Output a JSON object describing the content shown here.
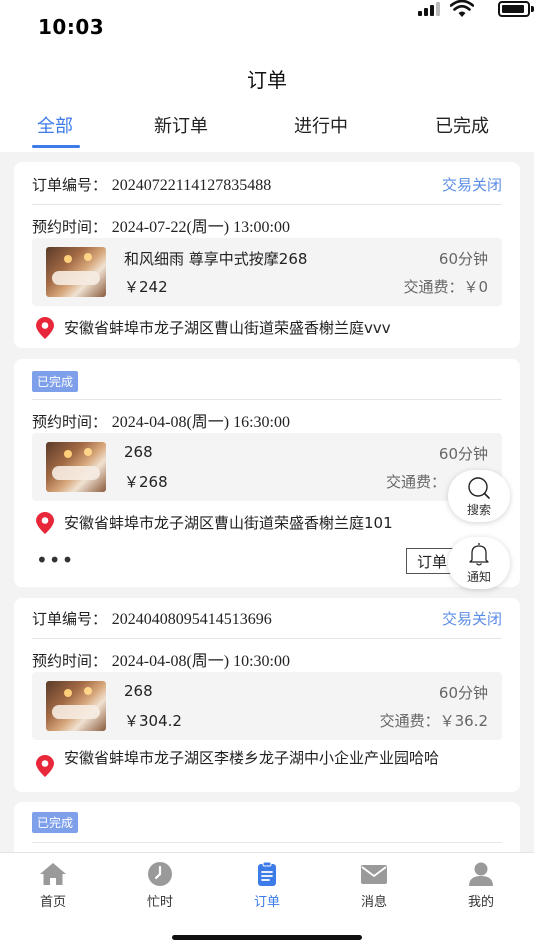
{
  "status_bar": {
    "time": "10:03"
  },
  "header": {
    "title": "订单"
  },
  "tabs": [
    {
      "label": "全部",
      "active": true
    },
    {
      "label": "新订单",
      "active": false
    },
    {
      "label": "进行中",
      "active": false
    },
    {
      "label": "已完成",
      "active": false
    }
  ],
  "orders": [
    {
      "order_no_label": "订单编号：",
      "order_no": "20240722114127835488",
      "status": "交易关闭",
      "time_label": "预约时间：",
      "time": "2024-07-22(周一) 13:00:00",
      "service_name": "和风细雨 尊享中式按摩268",
      "duration": "60分钟",
      "price": "￥242",
      "fee": "交通费：￥0",
      "address": "安徽省蚌埠市龙子湖区曹山街道荣盛香榭兰庭vvv"
    },
    {
      "badge": "已完成",
      "time_label": "预约时间：",
      "time": "2024-04-08(周一) 16:30:00",
      "service_name": "268",
      "duration": "60分钟",
      "price": "￥268",
      "fee": "交通费：",
      "address": "安徽省蚌埠市龙子湖区曹山街道荣盛香榭兰庭101",
      "more": "•••",
      "button": "订单"
    },
    {
      "order_no_label": "订单编号：",
      "order_no": "20240408095414513696",
      "status": "交易关闭",
      "time_label": "预约时间：",
      "time": "2024-04-08(周一) 10:30:00",
      "service_name": "268",
      "duration": "60分钟",
      "price": "￥304.2",
      "fee": "交通费：￥36.2",
      "address": "安徽省蚌埠市龙子湖区李楼乡龙子湖中小企业产业园哈哈"
    },
    {
      "badge": "已完成"
    }
  ],
  "floating": {
    "search": "搜索",
    "notify": "通知"
  },
  "tabbar": [
    {
      "label": "首页",
      "icon": "home-icon"
    },
    {
      "label": "忙时",
      "icon": "clock-icon"
    },
    {
      "label": "订单",
      "icon": "order-icon",
      "active": true
    },
    {
      "label": "消息",
      "icon": "mail-icon"
    },
    {
      "label": "我的",
      "icon": "person-icon"
    }
  ],
  "colors": {
    "accent": "#3d7be9",
    "status_closed": "#5b8de6",
    "badge_bg": "#7ea0ea",
    "pin": "#e8283a"
  }
}
